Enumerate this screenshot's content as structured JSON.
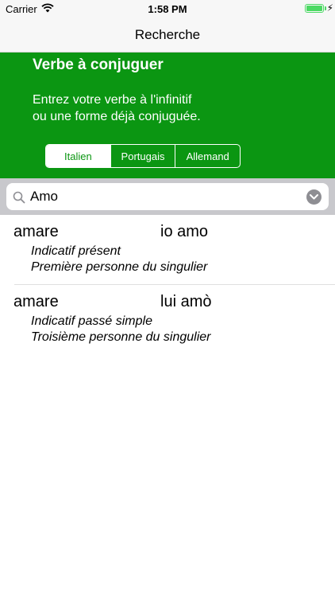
{
  "status_bar": {
    "carrier": "Carrier",
    "time": "1:58 PM",
    "battery_level": 1.0,
    "battery_color": "#4cd964"
  },
  "nav": {
    "title": "Recherche"
  },
  "header": {
    "background_color": "#0b9612",
    "title": "Verbe à conjuguer",
    "description": "Entrez votre verbe à l'infinitif\nou une forme déjà conjuguée.",
    "languages": [
      {
        "label": "Italien",
        "selected": true
      },
      {
        "label": "Portugais",
        "selected": false
      },
      {
        "label": "Allemand",
        "selected": false
      }
    ]
  },
  "search": {
    "value": "Amo",
    "icon": "search-icon",
    "clear_icon": "chevron-down-icon"
  },
  "results": [
    {
      "infinitive": "amare",
      "form": "io amo",
      "mood": "Indicatif présent",
      "person": "Première personne du singulier"
    },
    {
      "infinitive": "amare",
      "form": "lui amò",
      "mood": "Indicatif passé simple",
      "person": "Troisième personne du singulier"
    }
  ]
}
